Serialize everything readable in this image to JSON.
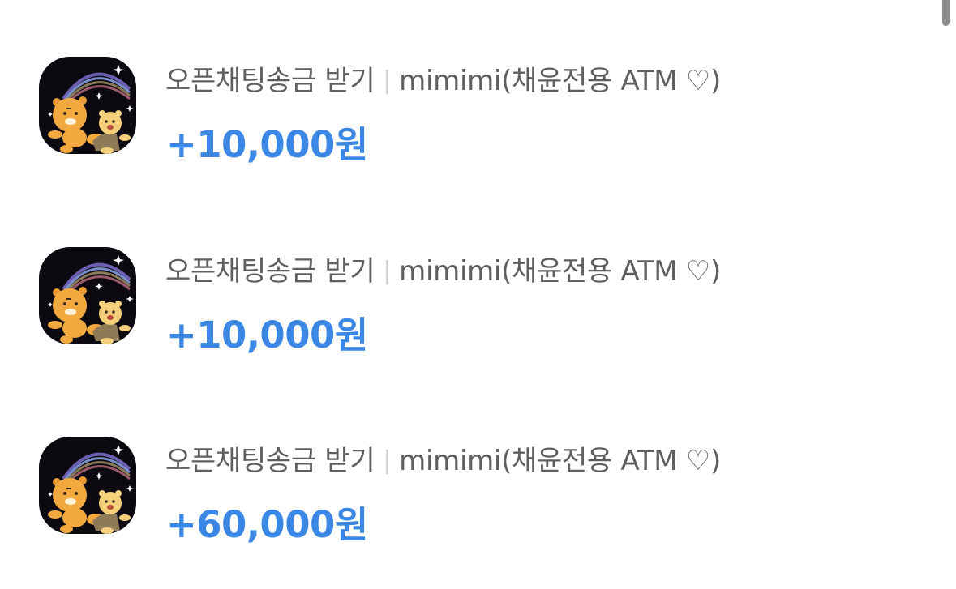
{
  "transactions": [
    {
      "type_label": "오픈채팅송금 받기",
      "separator": "|",
      "counterparty": "mimimi(채윤전용 ATM ♡)",
      "amount": "+10,000원",
      "icon": "kakao-friends-character-icon"
    },
    {
      "type_label": "오픈채팅송금 받기",
      "separator": "|",
      "counterparty": "mimimi(채윤전용 ATM ♡)",
      "amount": "+10,000원",
      "icon": "kakao-friends-character-icon"
    },
    {
      "type_label": "오픈채팅송금 받기",
      "separator": "|",
      "counterparty": "mimimi(채윤전용 ATM ♡)",
      "amount": "+60,000원",
      "icon": "kakao-friends-character-icon"
    }
  ],
  "colors": {
    "amount": "#3a87e6",
    "label": "#5f5f5f",
    "separator": "#cfcfcf",
    "icon_background": "#0c0a10"
  }
}
